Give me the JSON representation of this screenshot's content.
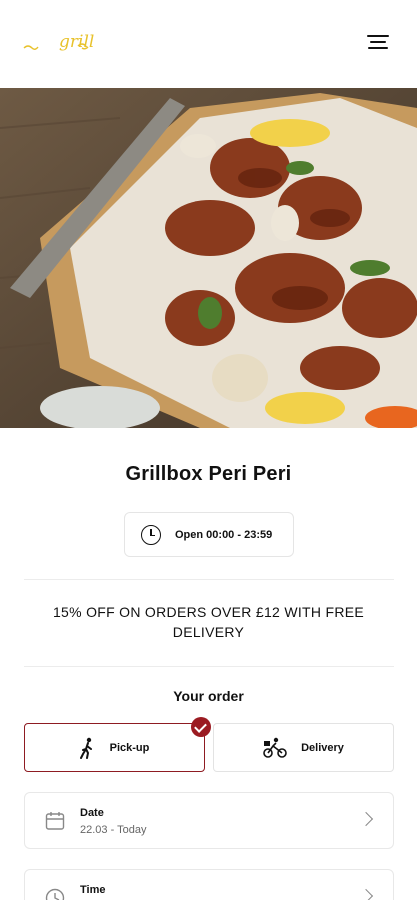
{
  "header": {
    "logo_text": "grill",
    "menu_icon": "hamburger-menu-icon"
  },
  "hero": {
    "image_description_icon": "grilled-chicken-photo"
  },
  "restaurant": {
    "name": "Grillbox Peri Peri",
    "hours": "Open 00:00 - 23:59",
    "clock_icon": "clock-icon"
  },
  "promo": {
    "text": "15% OFF ON ORDERS OVER £12 WITH FREE DELIVERY"
  },
  "order": {
    "label": "Your order",
    "modes": [
      {
        "label": "Pick-up",
        "icon": "walking-person-icon",
        "selected": true
      },
      {
        "label": "Delivery",
        "icon": "cyclist-icon",
        "selected": false
      }
    ],
    "date": {
      "title": "Date",
      "value": "22.03 - Today",
      "icon": "calendar-icon"
    },
    "time": {
      "title": "Time",
      "icon": "clock-icon"
    }
  },
  "colors": {
    "accent": "#9b1b22",
    "logo": "#e8c22c"
  }
}
